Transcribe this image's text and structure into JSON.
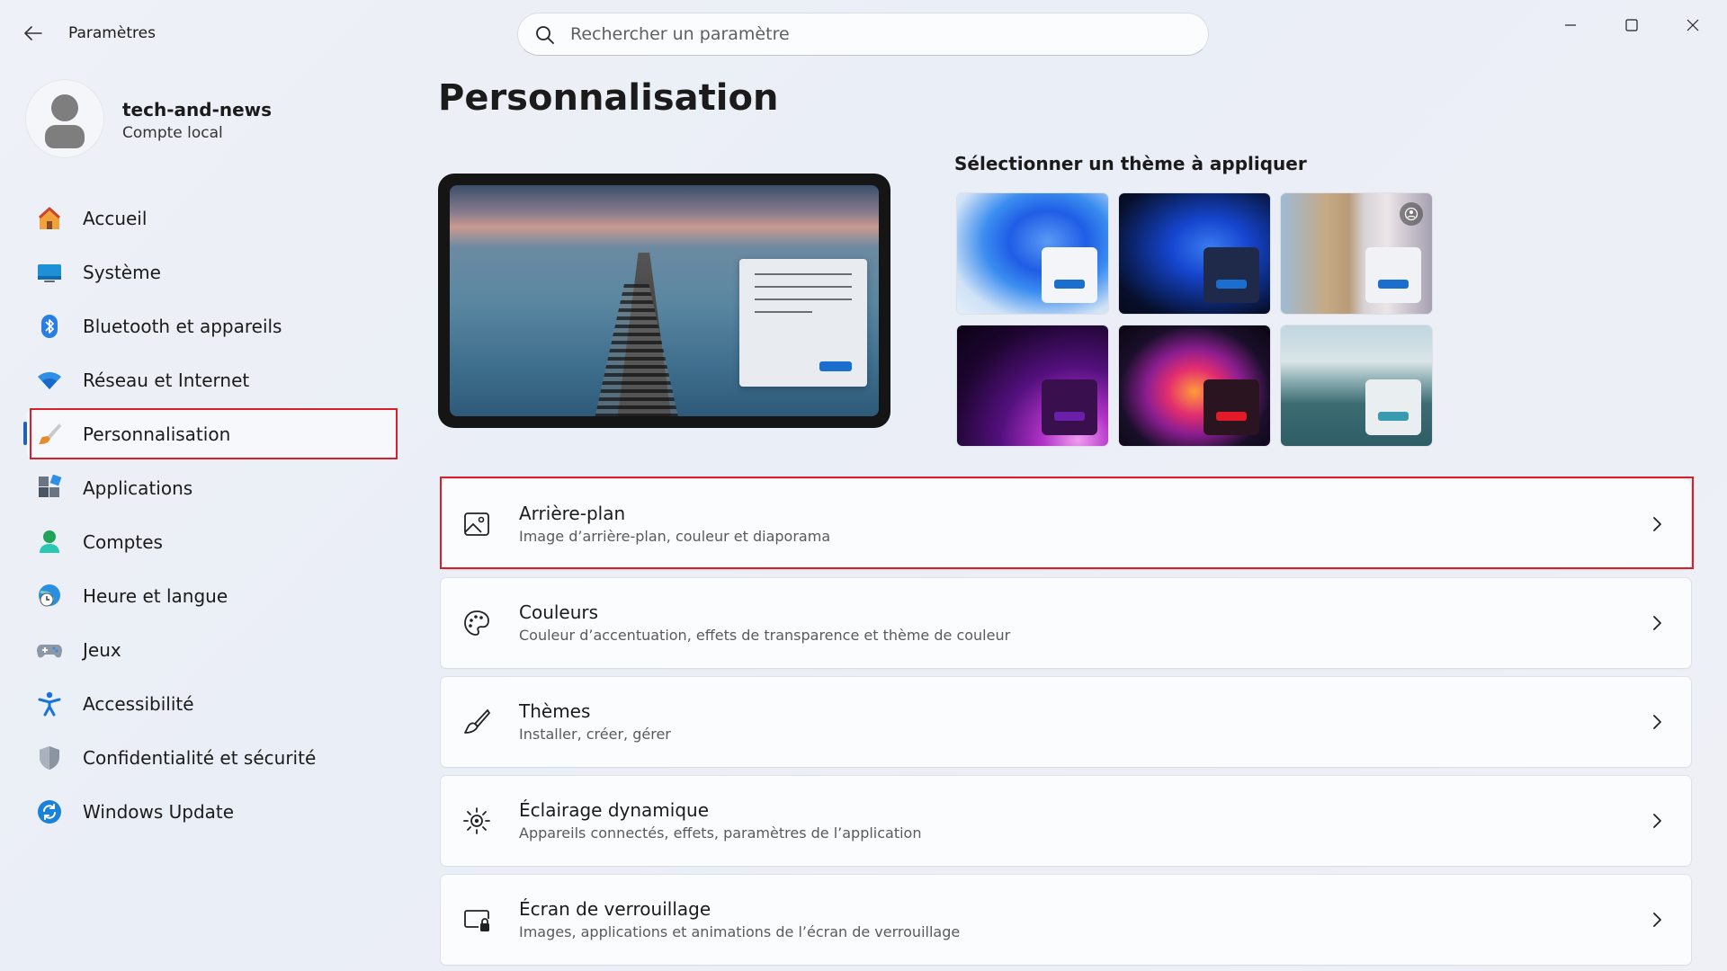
{
  "window": {
    "title": "Paramètres",
    "search_placeholder": "Rechercher un paramètre"
  },
  "profile": {
    "name": "tech-and-news",
    "account_type": "Compte local"
  },
  "sidebar": {
    "items": [
      {
        "label": "Accueil",
        "icon": "home-icon"
      },
      {
        "label": "Système",
        "icon": "monitor-icon"
      },
      {
        "label": "Bluetooth et appareils",
        "icon": "bluetooth-icon"
      },
      {
        "label": "Réseau et Internet",
        "icon": "wifi-icon"
      },
      {
        "label": "Personnalisation",
        "icon": "brush-icon",
        "selected": true
      },
      {
        "label": "Applications",
        "icon": "apps-icon"
      },
      {
        "label": "Comptes",
        "icon": "person-icon"
      },
      {
        "label": "Heure et langue",
        "icon": "globe-clock-icon"
      },
      {
        "label": "Jeux",
        "icon": "gamepad-icon"
      },
      {
        "label": "Accessibilité",
        "icon": "accessibility-icon"
      },
      {
        "label": "Confidentialité et sécurité",
        "icon": "shield-icon"
      },
      {
        "label": "Windows Update",
        "icon": "update-icon"
      }
    ]
  },
  "main": {
    "title": "Personnalisation",
    "themes_heading": "Sélectionner un thème à appliquer",
    "cards": [
      {
        "title": "Arrière-plan",
        "subtitle": "Image d’arrière-plan, couleur et diaporama",
        "icon": "image-icon",
        "highlighted": true
      },
      {
        "title": "Couleurs",
        "subtitle": "Couleur d’accentuation, effets de transparence et thème de couleur",
        "icon": "palette-icon"
      },
      {
        "title": "Thèmes",
        "subtitle": "Installer, créer, gérer",
        "icon": "brush-icon"
      },
      {
        "title": "Éclairage dynamique",
        "subtitle": "Appareils connectés, effets, paramètres de l’application",
        "icon": "lighting-icon"
      },
      {
        "title": "Écran de verrouillage",
        "subtitle": "Images, applications et animations de l’écran de verrouillage",
        "icon": "lock-screen-icon"
      }
    ]
  },
  "colors": {
    "accent": "#1a6fce",
    "highlight": "#d8202a",
    "selection_indicator": "#1f5fbf"
  }
}
